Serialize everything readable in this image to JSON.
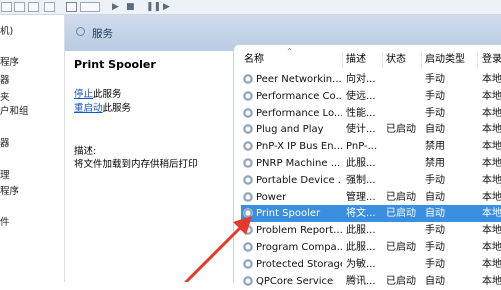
{
  "colors": {
    "header_band": "#c4d5e8",
    "selection": "#3b8fe0",
    "arrow": "#e53a2a",
    "link": "#1a55c4"
  },
  "left_tree": {
    "items": [
      "机)",
      "程序",
      "器",
      "夹",
      "户和组",
      "器",
      "理",
      "程序",
      "件"
    ]
  },
  "header": {
    "title": "服务"
  },
  "detail": {
    "service_name": "Print Spooler",
    "stop_link": "停止",
    "stop_suffix": "此服务",
    "restart_link": "重启动",
    "restart_suffix": "此服务",
    "desc_label": "描述:",
    "desc_text": "将文件加载到内存供稍后打印"
  },
  "columns": {
    "name": "名称",
    "desc": "描述",
    "status": "状态",
    "startup": "启动类型",
    "logon": "登录"
  },
  "services": [
    {
      "name": "Peer Networkin...",
      "desc": "向对...",
      "status": "",
      "startup": "手动",
      "logon": "本地"
    },
    {
      "name": "Performance Co...",
      "desc": "使远...",
      "status": "",
      "startup": "手动",
      "logon": "本地"
    },
    {
      "name": "Performance Lo...",
      "desc": "性能...",
      "status": "",
      "startup": "手动",
      "logon": "本地"
    },
    {
      "name": "Plug and Play",
      "desc": "使计...",
      "status": "已启动",
      "startup": "自动",
      "logon": "本地"
    },
    {
      "name": "PnP-X IP Bus En...",
      "desc": "PnP-...",
      "status": "",
      "startup": "禁用",
      "logon": "本地"
    },
    {
      "name": "PNRP Machine ...",
      "desc": "此服...",
      "status": "",
      "startup": "禁用",
      "logon": "本地"
    },
    {
      "name": "Portable Device ...",
      "desc": "强制...",
      "status": "",
      "startup": "手动",
      "logon": "本地"
    },
    {
      "name": "Power",
      "desc": "管理...",
      "status": "已启动",
      "startup": "自动",
      "logon": "本地"
    },
    {
      "name": "Print Spooler",
      "desc": "将文...",
      "status": "已启动",
      "startup": "自动",
      "logon": "本地",
      "selected": true
    },
    {
      "name": "Problem Report...",
      "desc": "此服...",
      "status": "",
      "startup": "手动",
      "logon": "本地"
    },
    {
      "name": "Program Compa...",
      "desc": "此服...",
      "status": "已启动",
      "startup": "手动",
      "logon": "本地"
    },
    {
      "name": "Protected Storage",
      "desc": "为敏...",
      "status": "",
      "startup": "手动",
      "logon": "本地"
    },
    {
      "name": "QPCore Service",
      "desc": "腾讯...",
      "status": "已启动",
      "startup": "自动",
      "logon": "本地"
    }
  ]
}
